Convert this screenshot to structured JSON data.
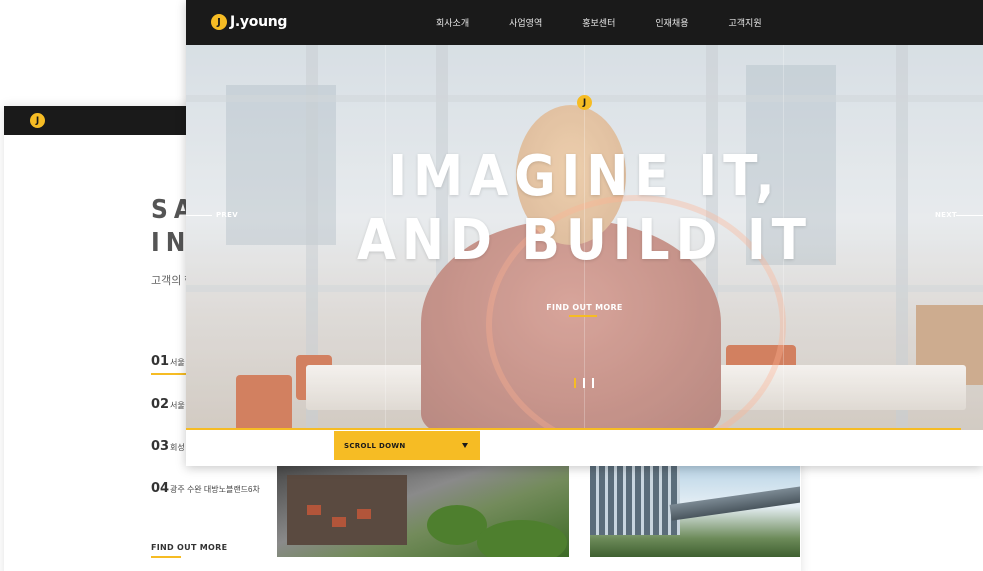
{
  "back_window": {
    "logo_glyph": "J",
    "section_title_line1": "SAL",
    "section_title_line2": "INF",
    "subtitle": "고객의 행",
    "items": [
      {
        "num": "01",
        "text": "서울 미"
      },
      {
        "num": "02",
        "text": "서울 미"
      },
      {
        "num": "03",
        "text": "회성 용"
      },
      {
        "num": "04",
        "text": "광주 수완 대방노블랜드6차"
      }
    ],
    "find_out_more": "FIND OUT MORE"
  },
  "front_window": {
    "brand": "J.young",
    "logo_glyph": "J",
    "menu": [
      "회사소개",
      "사업영역",
      "홍보센터",
      "인재채용",
      "고객지원"
    ],
    "hero": {
      "logo_glyph": "J",
      "headline_line1": "IMAGINE IT,",
      "headline_line2": "AND BUILD IT",
      "find_out_more": "FIND OUT MORE",
      "prev": "PREV",
      "next": "NEXT",
      "slide_count": 3,
      "active_slide": 1
    },
    "scroll_down": "SCROLL DOWN"
  },
  "colors": {
    "accent": "#f6bc24",
    "nav_bg": "#1a1a1a"
  }
}
